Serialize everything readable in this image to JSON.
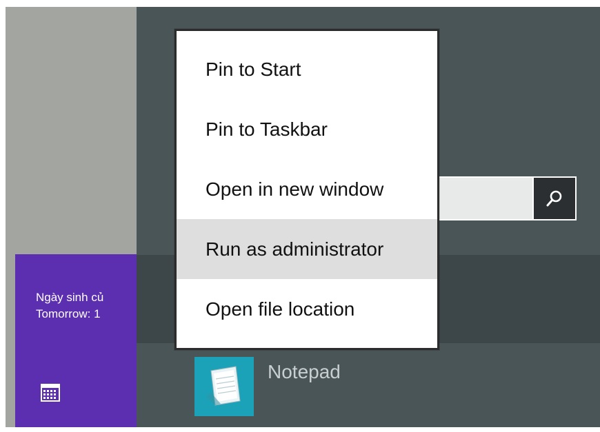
{
  "calendar_tile": {
    "line1": "Ngày sinh củ",
    "line2": "Tomorrow: 1",
    "icon": "calendar-icon"
  },
  "search": {
    "value": "",
    "icon": "search-icon"
  },
  "context_menu": {
    "items": [
      {
        "label": "Pin to Start"
      },
      {
        "label": "Pin to Taskbar"
      },
      {
        "label": "Open in new window"
      },
      {
        "label": "Run as administrator",
        "highlighted": true
      },
      {
        "label": "Open file location"
      }
    ]
  },
  "app": {
    "label": "Notepad",
    "icon": "notepad-icon"
  },
  "colors": {
    "tile_purple": "#5c2eb0",
    "pane_slate": "#4a5558",
    "app_tile_teal": "#1ba2b8",
    "menu_highlight": "#dedede"
  }
}
